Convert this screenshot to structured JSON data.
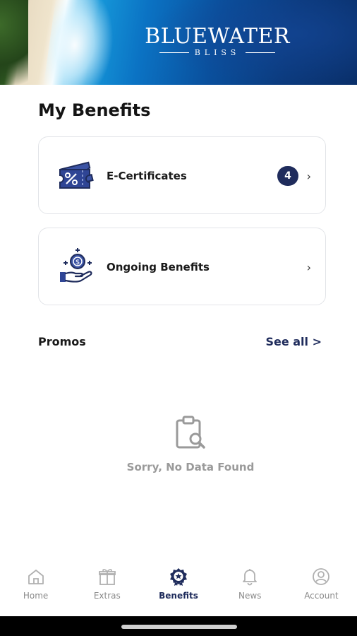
{
  "header": {
    "brand_title": "BLUEWATER",
    "brand_subtitle": "BLISS"
  },
  "page": {
    "title": "My Benefits"
  },
  "cards": [
    {
      "label": "E-Certificates",
      "badge": "4",
      "icon": "coupon-percent-icon",
      "chevron": "›"
    },
    {
      "label": "Ongoing Benefits",
      "icon": "hand-coin-icon",
      "chevron": "›"
    }
  ],
  "promos": {
    "label": "Promos",
    "see_all": "See all >",
    "empty_text": "Sorry, No Data Found",
    "empty_icon": "clipboard-search-icon"
  },
  "bottom_nav": {
    "items": [
      {
        "label": "Home",
        "icon": "home-icon",
        "active": false
      },
      {
        "label": "Extras",
        "icon": "gift-icon",
        "active": false
      },
      {
        "label": "Benefits",
        "icon": "badge-star-icon",
        "active": true
      },
      {
        "label": "News",
        "icon": "bell-icon",
        "active": false
      },
      {
        "label": "Account",
        "icon": "user-circle-icon",
        "active": false
      }
    ]
  },
  "colors": {
    "accent": "#1f2c5c",
    "muted": "#8a8a8a"
  }
}
